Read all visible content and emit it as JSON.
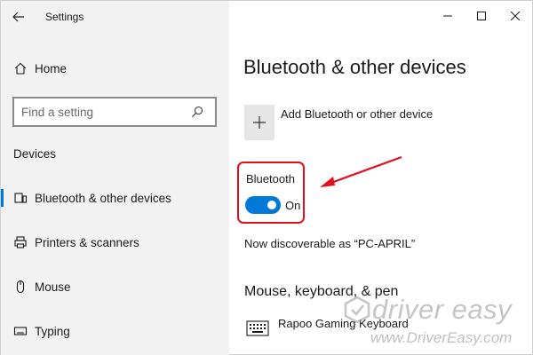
{
  "window": {
    "title": "Settings",
    "controls": {
      "minimize_icon": "minimize-icon",
      "maximize_icon": "maximize-icon",
      "close_icon": "close-icon"
    }
  },
  "sidebar": {
    "home_label": "Home",
    "search_placeholder": "Find a setting",
    "section_heading": "Devices",
    "items": [
      {
        "label": "Bluetooth & other devices",
        "icon": "bluetooth-devices-icon",
        "active": true
      },
      {
        "label": "Printers & scanners",
        "icon": "printer-icon",
        "active": false
      },
      {
        "label": "Mouse",
        "icon": "mouse-icon",
        "active": false
      },
      {
        "label": "Typing",
        "icon": "keyboard-icon",
        "active": false
      }
    ]
  },
  "main": {
    "page_title": "Bluetooth & other devices",
    "add_device_label": "Add Bluetooth or other device",
    "bluetooth": {
      "label": "Bluetooth",
      "state_label": "On",
      "enabled": true
    },
    "discoverable_text": "Now discoverable as “PC-APRIL”",
    "section_mouse_keyboard": "Mouse, keyboard, & pen",
    "devices": [
      {
        "name": "Rapoo Gaming Keyboard",
        "icon": "keyboard-icon"
      }
    ]
  },
  "watermark": {
    "brand": "driver easy",
    "url": "www.DriverEasy.com"
  },
  "colors": {
    "accent": "#0078d7",
    "highlight_red": "#e0101a",
    "sidebar_bg": "#f2f2f2"
  }
}
